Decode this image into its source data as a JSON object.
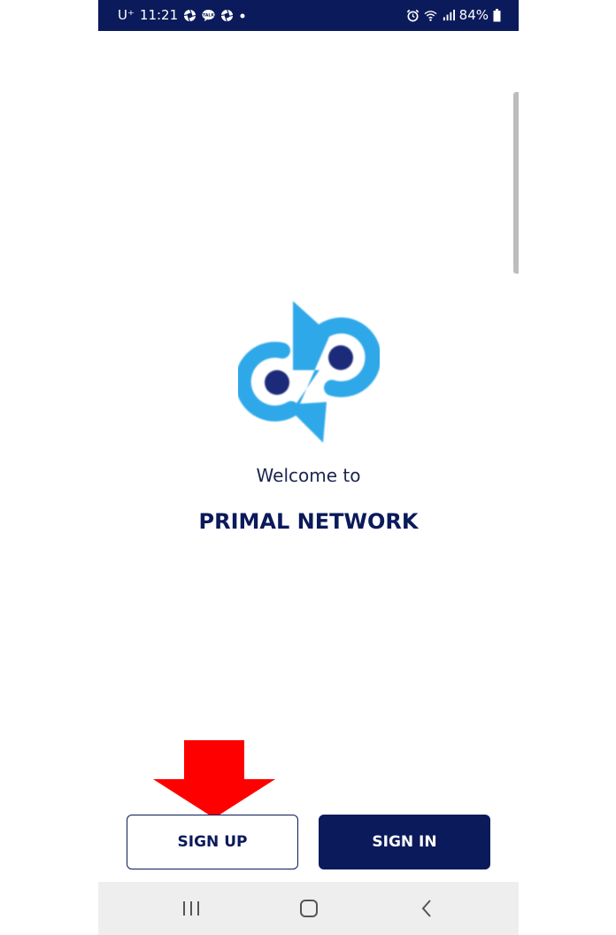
{
  "status_bar": {
    "carrier": "U⁺",
    "time": "11:21",
    "battery": "84%",
    "icons": [
      "aperture-icon",
      "talk-icon",
      "aperture-icon",
      "dot-icon",
      "alarm-icon",
      "wifi-icon",
      "signal-icon",
      "battery-icon"
    ]
  },
  "welcome": {
    "greeting": "Welcome to",
    "brand_name": "PRIMAL NETWORK"
  },
  "buttons": {
    "sign_up": "SIGN UP",
    "sign_in": "SIGN IN"
  },
  "nav": {
    "icons": [
      "recent-apps-icon",
      "home-icon",
      "back-icon"
    ]
  },
  "colors": {
    "primary": "#0b1a5a",
    "logo_blue": "#2fa8e8",
    "logo_dot": "#1d2b7a",
    "annotation_red": "#ff0000"
  }
}
